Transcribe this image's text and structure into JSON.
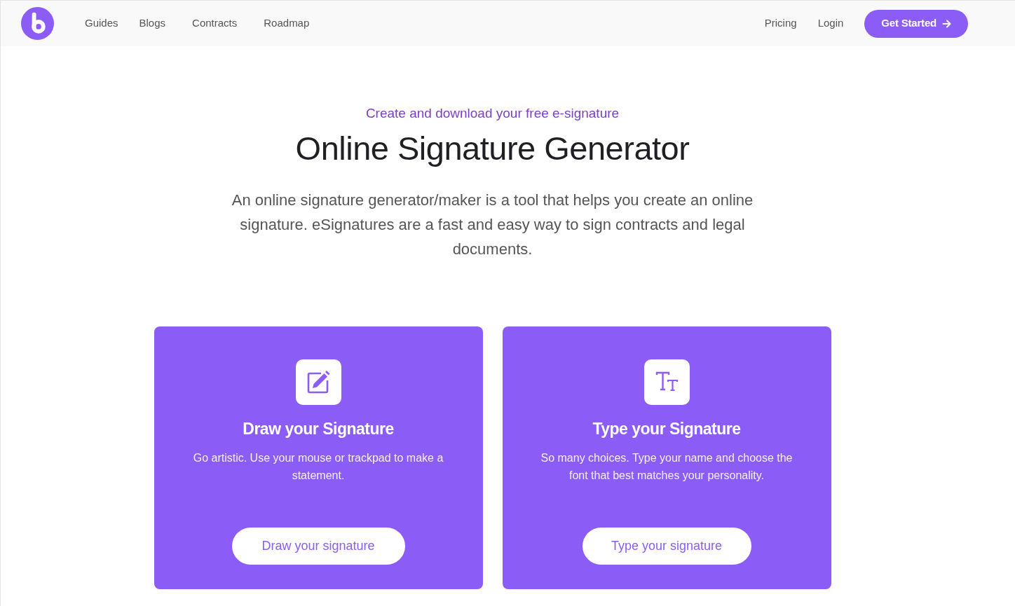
{
  "navbar": {
    "links": [
      {
        "label": "Guides"
      },
      {
        "label": "Blogs"
      },
      {
        "label": "Contracts"
      },
      {
        "label": "Roadmap"
      }
    ],
    "right_links": [
      {
        "label": "Pricing"
      },
      {
        "label": "Login"
      }
    ],
    "cta": "Get Started"
  },
  "hero": {
    "eyebrow": "Create and download your free e-signature",
    "title": "Online Signature Generator",
    "description": "An online signature generator/maker is a tool that helps you create an online signature. eSignatures are a fast and easy way to sign contracts and legal documents."
  },
  "cards": [
    {
      "kind": "draw",
      "title": "Draw your Signature",
      "description": "Go artistic. Use your mouse or trackpad to make a statement.",
      "button": "Draw your signature"
    },
    {
      "kind": "type",
      "title": "Type your Signature",
      "description": "So many choices. Type your name and choose the font that best matches your personality.",
      "button": "Type your signature"
    }
  ]
}
